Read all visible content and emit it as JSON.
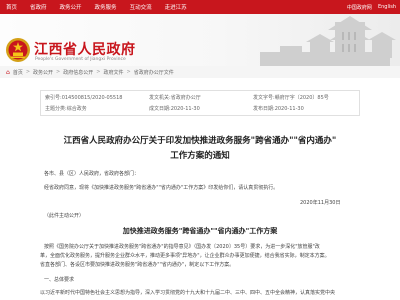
{
  "topnav": {
    "items": [
      "首页",
      "省政府",
      "政务公开",
      "政务服务",
      "互动交流",
      "走进江苏"
    ],
    "lang": [
      "中国政府网",
      "English"
    ]
  },
  "header": {
    "title": "江西省人民政府",
    "subtitle": "People's Government of Jiangxi Province"
  },
  "breadcrumb": [
    "首页",
    "政务公开",
    "政府信息公开",
    "政府文件",
    "省政府办公厅文件"
  ],
  "meta": {
    "index_label": "索引号:",
    "index_value": "014500815/2020-05518",
    "category_label": "主题分类:",
    "category_value": "综合政务",
    "org_label": "发文机关:",
    "org_value": "省政府办公厅",
    "date_label": "成文日期:",
    "date_value": "2020-11-30",
    "doc_no_label": "发文字号:",
    "doc_no_value": "赣府厅字〔2020〕85号",
    "pub_date_label": "发布日期:",
    "pub_date_value": "2020-11-30"
  },
  "article": {
    "title_line1": "江西省人民政府办公厅关于印发加快推进政务服务\"跨省通办\"\"省内通办\"",
    "title_line2": "工作方案的通知",
    "doc_no": "赣府厅字〔2020〕85号",
    "greeting": "各市、县（区）人民政府，省政府各部门：",
    "body1": "经省政府同意，现将《加快推进政务服务\"跨省通办\"\"省内通办\"工作方案》印发给你们，请认真贯彻执行。",
    "sign_date": "2020年11月30日",
    "note": "（此件主动公开）",
    "sub_title": "加快推进政务服务\"跨省通办\"\"省内通办\"工作方案",
    "body2a": "按照《国务院办公厅关于加快推进政务服务\"跨省通办\"的指导意见》（国办发〔2020〕35号）要求，为进一步深化\"放管服\"改",
    "body2b": "革，全面优化政务服务，提升服务企业群众水平，推动更多事项\"异地办\"，让企业群众办事更加便捷，结合我省实际，制定本方案。",
    "body2c": "省直各部门、各设区市要加快推进政务服务\"跨省通办\"\"省内通办\"，制定以下工作方案。",
    "section1": "一、总体要求",
    "body3": "以习近平新时代中国特色社会主义思想为指导，深入学习贯彻党的十九大和十九届二中、三中、四中、五中全会精神，认真落实党中央"
  }
}
